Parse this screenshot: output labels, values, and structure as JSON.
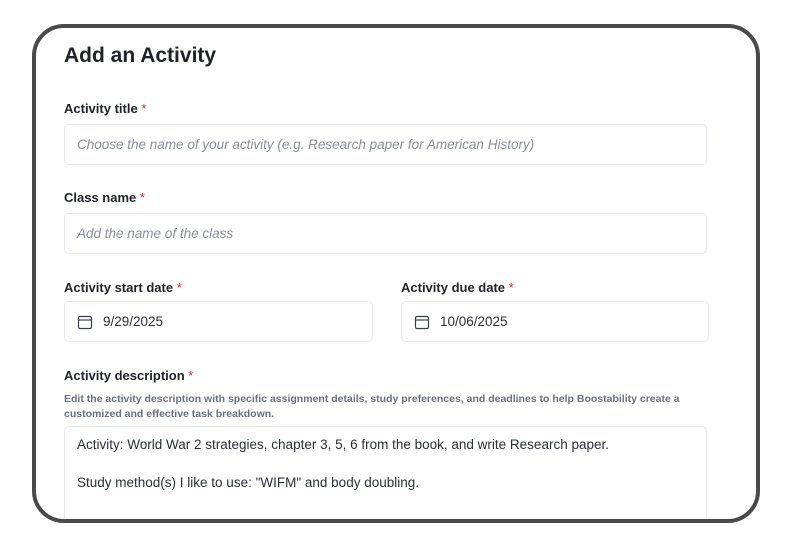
{
  "form": {
    "heading": "Add an Activity",
    "required_marker": "*",
    "activity_title": {
      "label": "Activity title",
      "placeholder": "Choose the name of your activity (e.g. Research paper for American History)"
    },
    "class_name": {
      "label": "Class name",
      "placeholder": "Add the name of the class"
    },
    "start_date": {
      "label": "Activity start date",
      "value": "9/29/2025",
      "icon": "calendar-icon"
    },
    "due_date": {
      "label": "Activity due date",
      "value": "10/06/2025",
      "icon": "calendar-icon"
    },
    "description": {
      "label": "Activity description",
      "hint": "Edit the activity description with specific assignment details, study preferences, and deadlines to help Boostability create a customized and effective task breakdown.",
      "value": "Activity: World War 2 strategies, chapter 3, 5, 6 from the book, and write Research paper.\n\nStudy method(s) I like to use: \"WIFM\" and body doubling."
    }
  }
}
